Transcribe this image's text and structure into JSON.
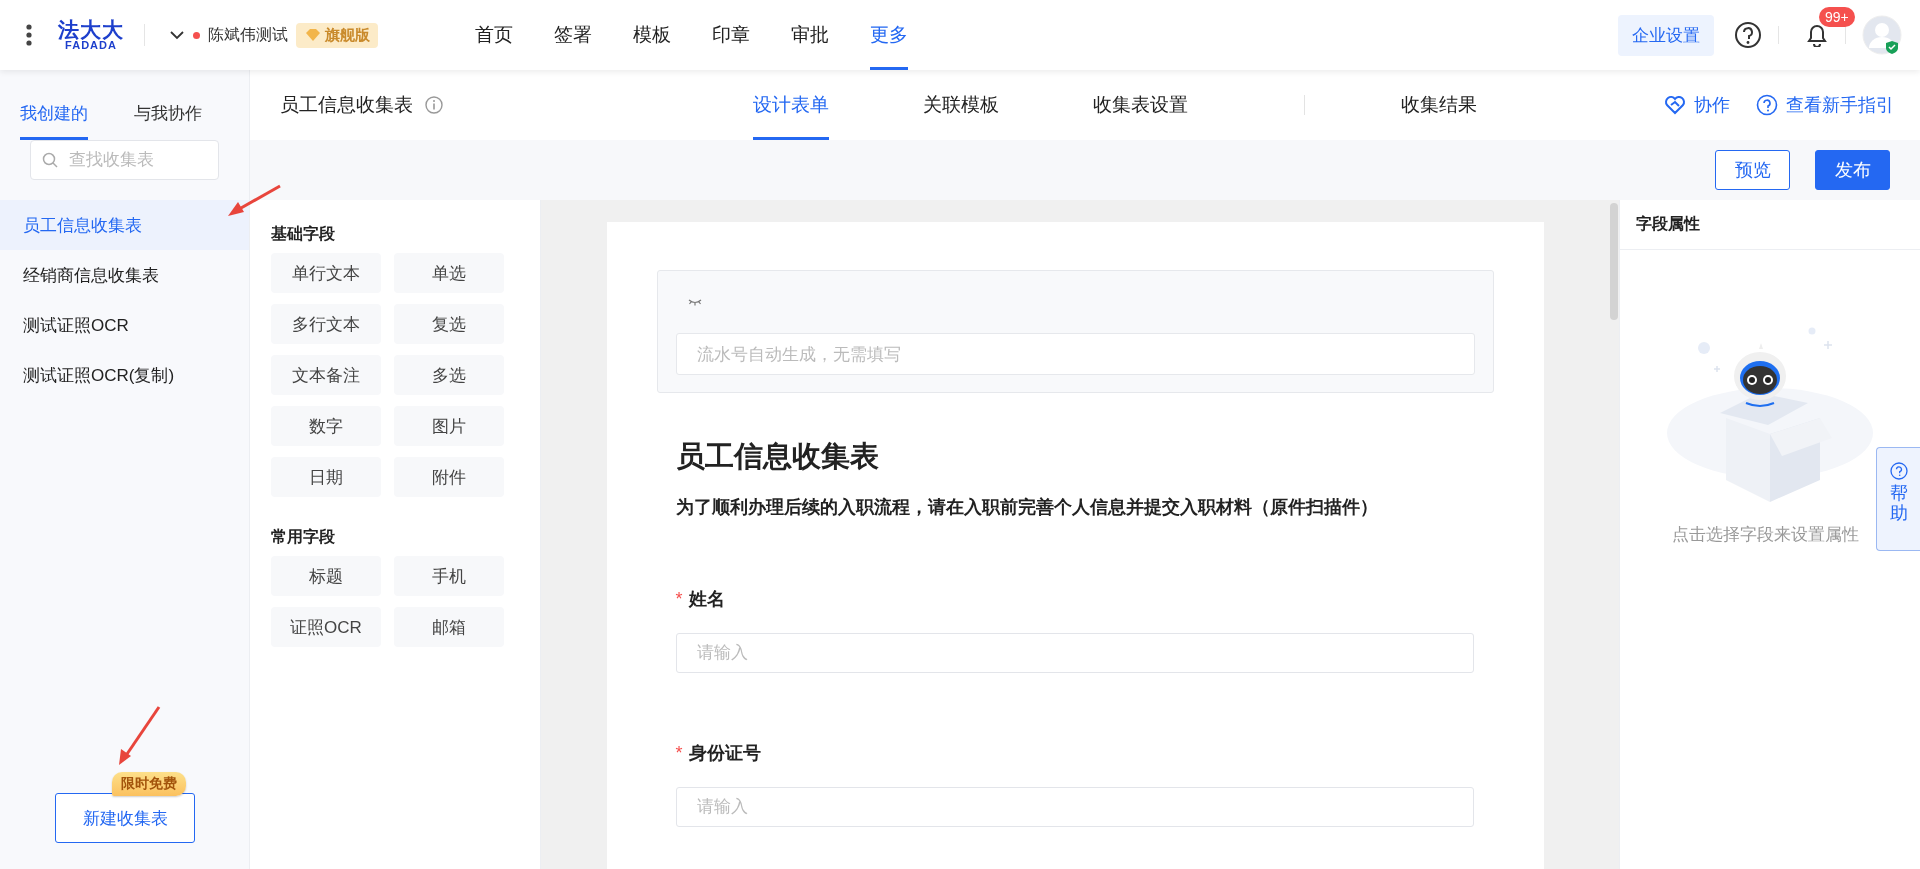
{
  "topbar": {
    "logo_text": "法大大",
    "logo_subtext": "FADADA",
    "account": "陈斌伟测试",
    "edition_badge": "旗舰版",
    "nav": [
      {
        "label": "首页",
        "selected": false
      },
      {
        "label": "签署",
        "selected": false
      },
      {
        "label": "模板",
        "selected": false
      },
      {
        "label": "印章",
        "selected": false
      },
      {
        "label": "审批",
        "selected": false
      },
      {
        "label": "更多",
        "selected": true
      }
    ],
    "enterprise_button": "企业设置",
    "notification_badge": "99+"
  },
  "sidebar": {
    "tabs": [
      {
        "label": "我创建的",
        "selected": true
      },
      {
        "label": "与我协作",
        "selected": false
      }
    ],
    "search": {
      "placeholder": "查找收集表"
    },
    "items": [
      {
        "label": "员工信息收集表",
        "selected": true
      },
      {
        "label": "经销商信息收集表",
        "selected": false
      },
      {
        "label": "测试证照OCR",
        "selected": false
      },
      {
        "label": "测试证照OCR(复制)",
        "selected": false
      }
    ],
    "create_button": "新建收集表",
    "promo_badge": "限时免费"
  },
  "header": {
    "title": "员工信息收集表",
    "tabs": [
      {
        "label": "设计表单",
        "selected": true
      },
      {
        "label": "关联模板",
        "selected": false
      },
      {
        "label": "收集表设置",
        "selected": false
      },
      {
        "label": "收集结果",
        "selected": false
      }
    ],
    "collaborate": "协作",
    "guide": "查看新手指引",
    "preview_button": "预览",
    "publish_button": "发布"
  },
  "palette": {
    "groups": [
      {
        "title": "基础字段",
        "items": [
          "单行文本",
          "单选",
          "多行文本",
          "复选",
          "文本备注",
          "多选",
          "数字",
          "图片",
          "日期",
          "附件"
        ]
      },
      {
        "title": "常用字段",
        "items": [
          "标题",
          "手机",
          "证照OCR",
          "邮箱"
        ]
      }
    ]
  },
  "form": {
    "serial_placeholder": "流水号自动生成，无需填写",
    "title": "员工信息收集表",
    "description": "为了顺利办理后续的入职流程，请在入职前完善个人信息并提交入职材料（原件扫描件）",
    "fields": [
      {
        "label": "姓名",
        "required": true,
        "required_mark": "*",
        "placeholder": "请输入"
      },
      {
        "label": "身份证号",
        "required": true,
        "required_mark": "*",
        "placeholder": "请输入"
      }
    ]
  },
  "properties": {
    "title": "字段属性",
    "hint": "点击选择字段来设置属性"
  },
  "help_tab": "帮助"
}
